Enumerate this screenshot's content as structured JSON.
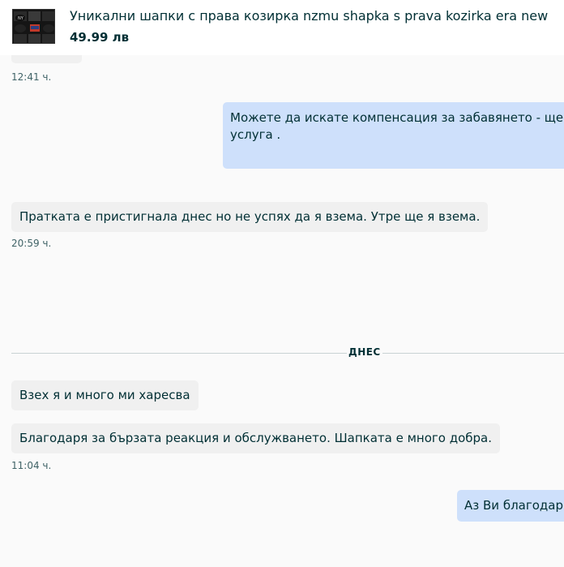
{
  "product": {
    "title": "Уникални шапки с права козирка nzmu shapka s prava kozirka era new",
    "price": "49.99 лв",
    "thumbnail_icon": "product-thumbnail-image"
  },
  "messages": [
    {
      "time": "12:41 ч."
    },
    {
      "direction": "outgoing",
      "line1": "Можете да искате компенсация за забавянето - ще Ви п",
      "line2": "услуга ."
    },
    {
      "direction": "incoming",
      "text": "Пратката е пристигнала днес но не успях да я взема. Утре ще я взема.",
      "time": "20:59 ч."
    },
    {
      "divider": "ДНЕС"
    },
    {
      "direction": "incoming",
      "text": "Взех я и много ми харесва"
    },
    {
      "direction": "incoming",
      "text": "Благодаря за бързата реакция и обслужването. Шапката е много добра.",
      "time": "11:04 ч."
    },
    {
      "direction": "outgoing",
      "text": "Аз Ви благодаря"
    }
  ],
  "colors": {
    "background": "#fafafa",
    "incoming_bubble": "#f0f0f0",
    "outgoing_bubble": "#cee0fb",
    "text": "#002f34"
  }
}
